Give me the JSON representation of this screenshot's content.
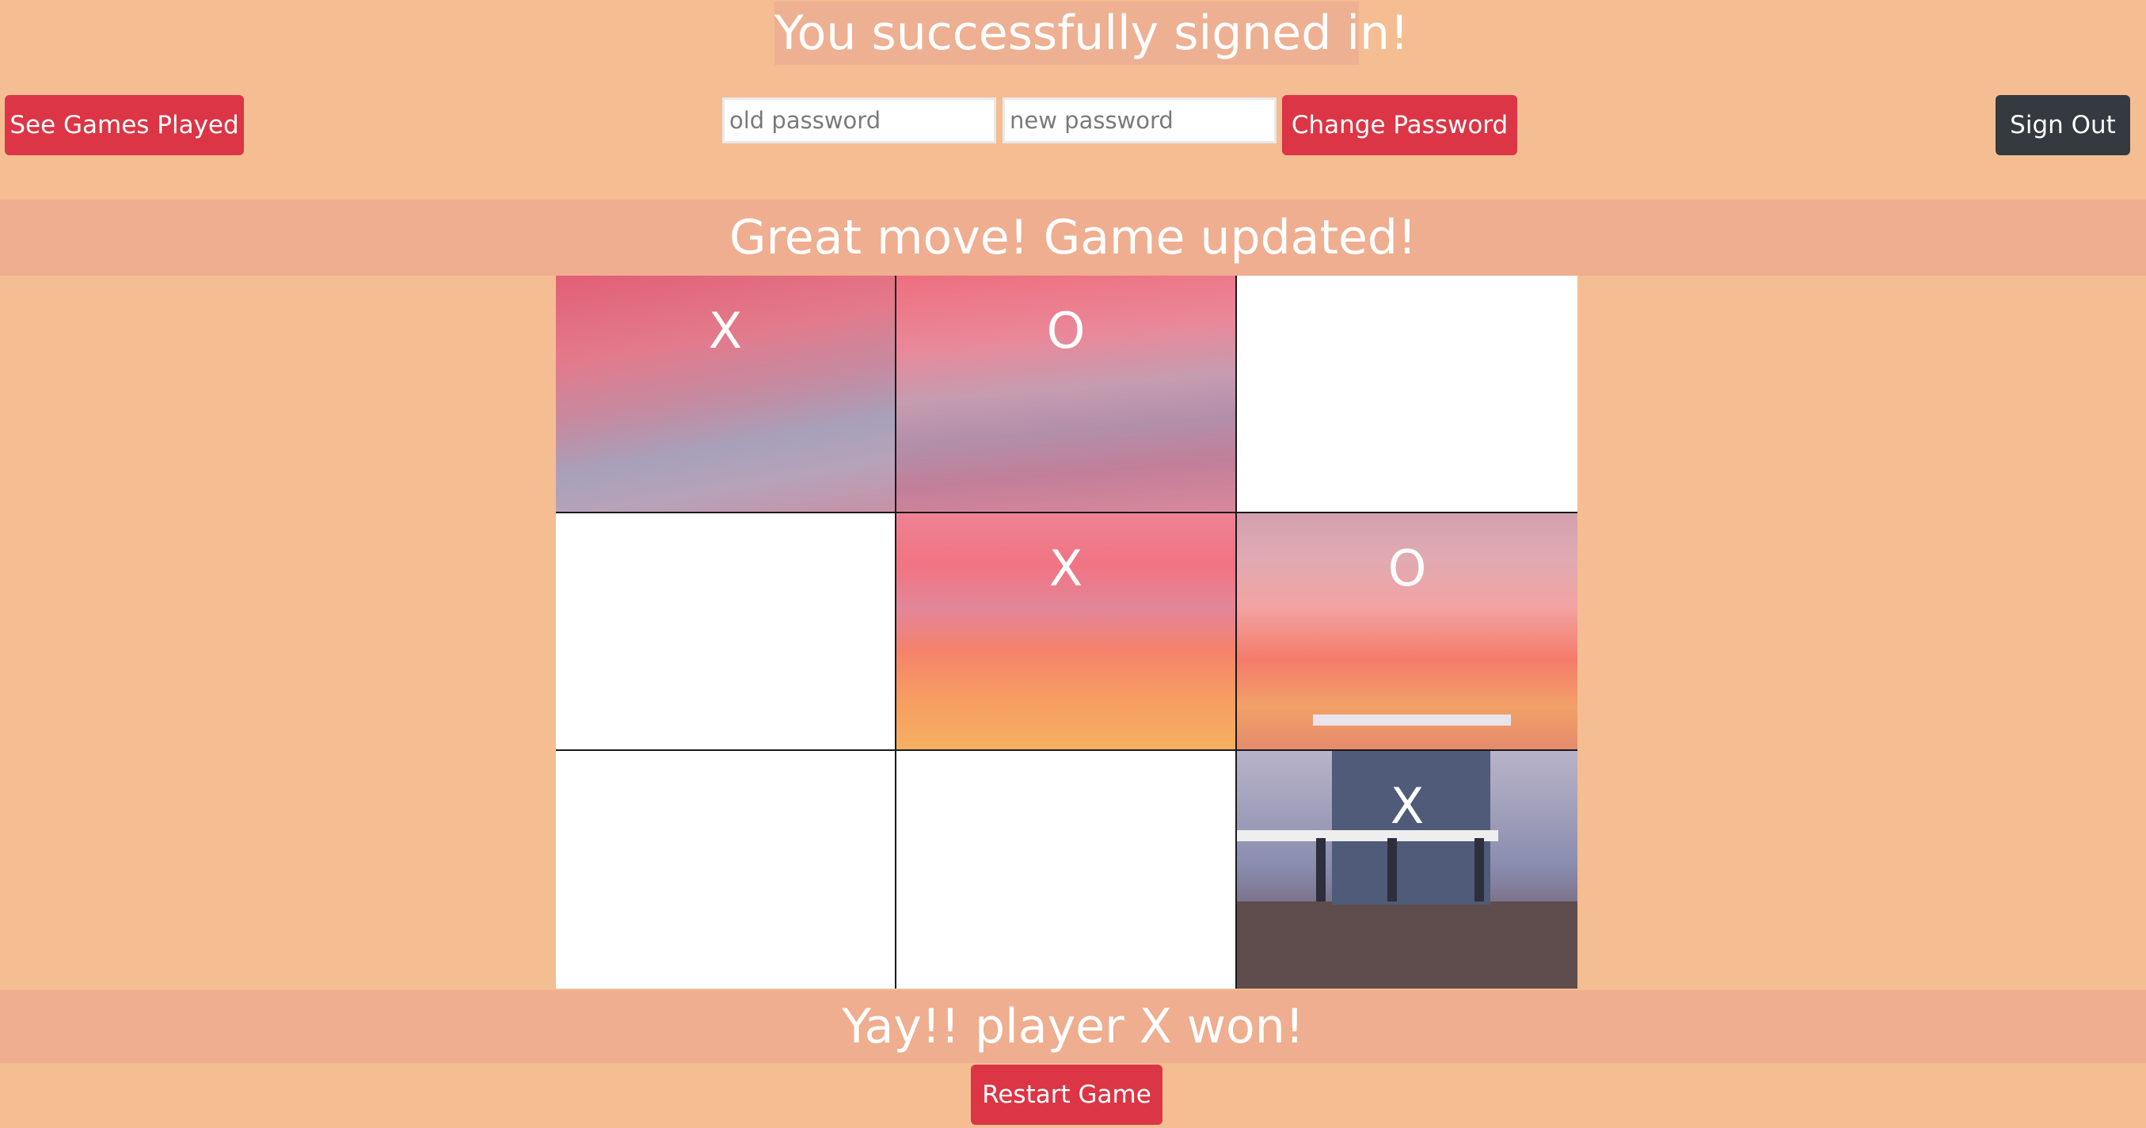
{
  "header": {
    "signin_message": "You successfully signed in!"
  },
  "toolbar": {
    "games_played_label": "See Games Played",
    "old_password_placeholder": "old password",
    "new_password_placeholder": "new password",
    "change_password_label": "Change Password",
    "sign_out_label": "Sign Out"
  },
  "status": {
    "move_message": "Great move! Game updated!",
    "result_message": "Yay!! player X won!"
  },
  "board": {
    "cells": [
      "X",
      "O",
      "",
      "",
      "X",
      "O",
      "",
      "",
      "X"
    ]
  },
  "footer": {
    "restart_label": "Restart Game"
  },
  "colors": {
    "page_background": "#f5bd92",
    "banner_background": "#eeae8f",
    "button_red": "#dc3545",
    "button_dark": "#343a40"
  }
}
